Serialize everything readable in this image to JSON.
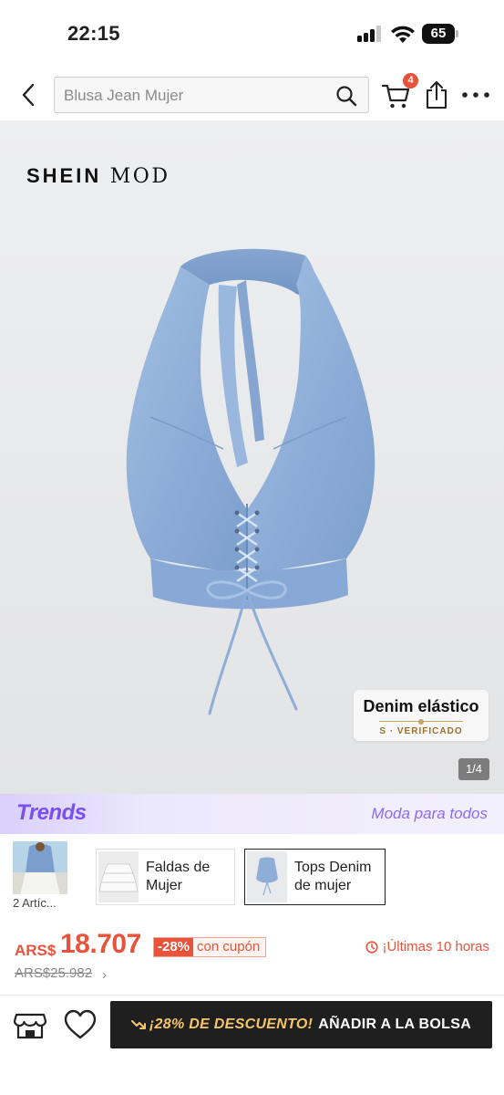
{
  "status_bar": {
    "time": "22:15",
    "battery": "65"
  },
  "header": {
    "search_placeholder": "Blusa Jean Mujer",
    "cart_count": "4"
  },
  "gallery": {
    "brand_bold": "SHEIN",
    "brand_thin": "MOD",
    "feature_title": "Denim elástico",
    "feature_sub": "S · VERIFICADO",
    "page_indicator": "1/4"
  },
  "trends": {
    "logo": "Trends",
    "tagline": "Moda para todos",
    "thumb_label": "2 Artíc...",
    "cards": [
      {
        "label": "Faldas de Mujer"
      },
      {
        "label": "Tops Denim de mujer"
      }
    ]
  },
  "price": {
    "currency": "ARS$",
    "value": "18.707",
    "discount_pct": "-28%",
    "discount_text": "con cupón",
    "timer": "¡Últimas 10 horas",
    "old_price": "ARS$25.982"
  },
  "action_bar": {
    "promo": "¡28% DE DESCUENTO!",
    "add_label": "AÑADIR A LA BOLSA"
  },
  "colors": {
    "accent": "#e8533b",
    "trends_purple": "#7a4ef0",
    "button_dark": "#1f1f1f",
    "denim": "#8fb0d8"
  }
}
